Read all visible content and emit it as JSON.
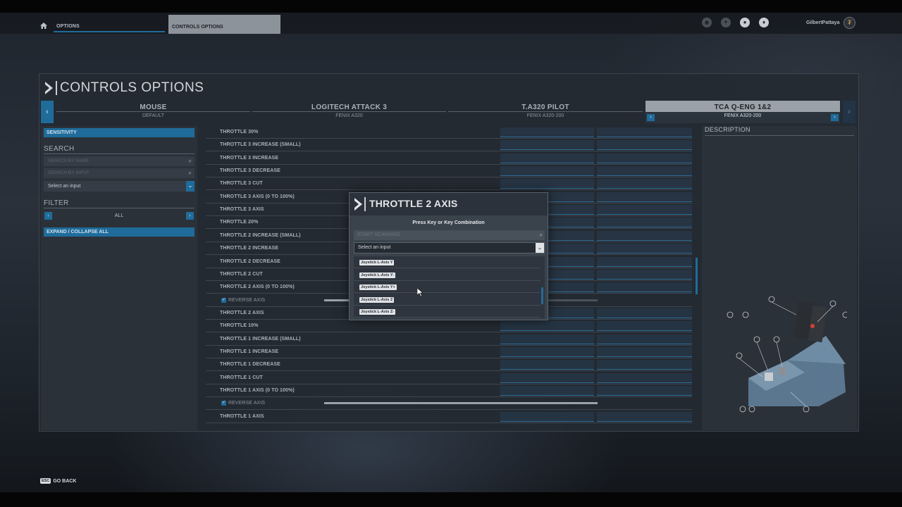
{
  "topnav": {
    "breadcrumb_1": "OPTIONS",
    "breadcrumb_2": "CONTROLS OPTIONS",
    "username": "GilbertPattaya"
  },
  "panel": {
    "title": "CONTROLS OPTIONS"
  },
  "tabs": [
    {
      "name": "MOUSE",
      "sub": "DEFAULT"
    },
    {
      "name": "LOGITECH ATTACK 3",
      "sub": "FENIX A320"
    },
    {
      "name": "T.A320 PILOT",
      "sub": "FENIX A320-200"
    },
    {
      "name": "TCA Q-ENG 1&2",
      "sub": "FENIX A320-200"
    }
  ],
  "left": {
    "sensitivity": "SENSITIVITY",
    "search_label": "SEARCH",
    "search_by_name": "SEARCH BY NAME",
    "search_by_input": "SEARCH BY INPUT",
    "select_input": "Select an input",
    "filter_label": "FILTER",
    "filter_value": "ALL",
    "expand_collapse": "EXPAND / COLLAPSE ALL"
  },
  "rows": [
    {
      "label": "THROTTLE 30%"
    },
    {
      "label": "THROTTLE 3 INCREASE (SMALL)"
    },
    {
      "label": "THROTTLE 3 INCREASE"
    },
    {
      "label": "THROTTLE 3 DECREASE"
    },
    {
      "label": "THROTTLE 3 CUT"
    },
    {
      "label": "THROTTLE 3 AXIS (0 TO 100%)"
    },
    {
      "label": "THROTTLE 3 AXIS"
    },
    {
      "label": "THROTTLE 20%"
    },
    {
      "label": "THROTTLE 2 INCREASE (SMALL)"
    },
    {
      "label": "THROTTLE 2 INCREASE"
    },
    {
      "label": "THROTTLE 2 DECREASE"
    },
    {
      "label": "THROTTLE 2 CUT"
    },
    {
      "label": "THROTTLE 2 AXIS (0 TO 100%)"
    },
    {
      "label": "REVERSE AXIS",
      "sub": true,
      "slider": 0.5
    },
    {
      "label": "THROTTLE 2 AXIS"
    },
    {
      "label": "THROTTLE 10%"
    },
    {
      "label": "THROTTLE 1 INCREASE (SMALL)"
    },
    {
      "label": "THROTTLE 1 INCREASE"
    },
    {
      "label": "THROTTLE 1 DECREASE"
    },
    {
      "label": "THROTTLE 1 CUT"
    },
    {
      "label": "THROTTLE 1 AXIS (0 TO 100%)"
    },
    {
      "label": "REVERSE AXIS",
      "sub": true,
      "slider": 1.0
    },
    {
      "label": "THROTTLE 1 AXIS"
    }
  ],
  "description": {
    "title": "DESCRIPTION"
  },
  "modal": {
    "title": "THROTTLE 2 AXIS",
    "instruction": "Press Key or Key Combination",
    "scan_placeholder": "START SCANNING",
    "select_input": "Select an input",
    "options": [
      "Joystick L-Axis Y",
      "Joystick L-Axis Y-",
      "Joystick L-Axis Y+",
      "Joystick L-Axis Z",
      "Joystick L-Axis Z-"
    ]
  },
  "footer": {
    "esc": "ESC",
    "go_back": "GO BACK"
  },
  "colors": {
    "accent": "#1f6c9b",
    "panel": "#242a32"
  }
}
